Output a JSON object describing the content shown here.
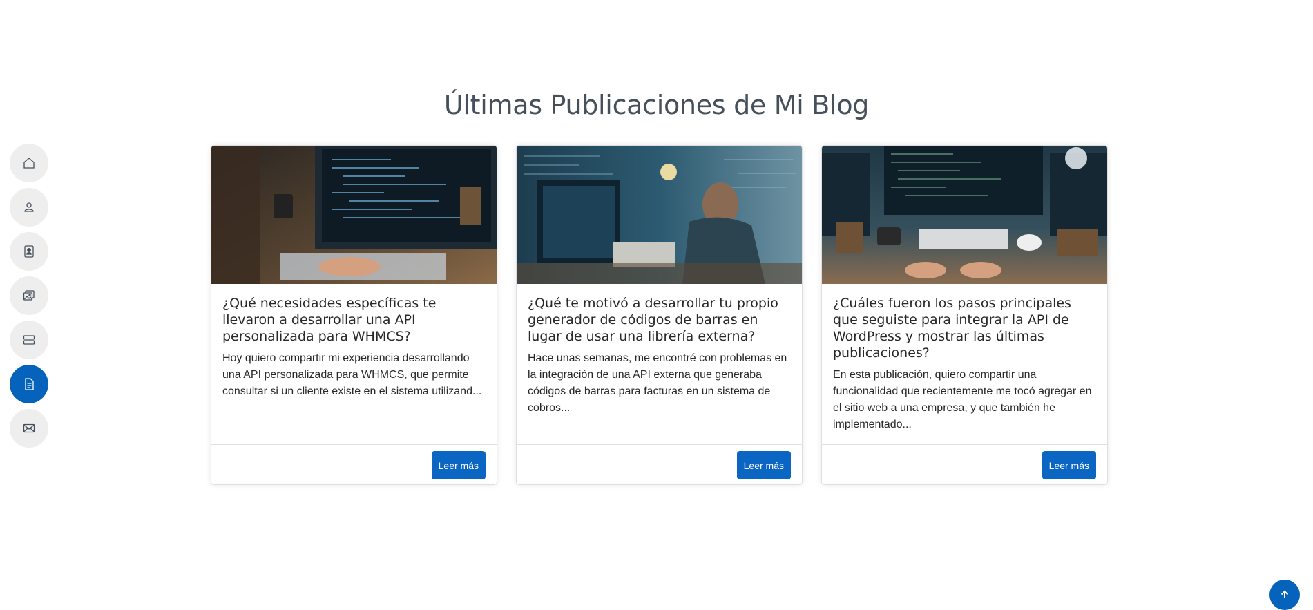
{
  "section": {
    "title": "Últimas Publicaciones de Mi Blog"
  },
  "nav": {
    "items": [
      {
        "icon": "house-icon",
        "active": false
      },
      {
        "icon": "person-icon",
        "active": false
      },
      {
        "icon": "file-person-icon",
        "active": false
      },
      {
        "icon": "images-icon",
        "active": false
      },
      {
        "icon": "server-icon",
        "active": false
      },
      {
        "icon": "file-text-icon",
        "active": true
      },
      {
        "icon": "envelope-icon",
        "active": false
      }
    ]
  },
  "posts": [
    {
      "title": "¿Qué necesidades específicas te llevaron a desarrollar una API personalizada para WHMCS?",
      "excerpt": "Hoy quiero compartir mi experiencia desarrollando una API personalizada para WHMCS, que permite consultar si un cliente existe en el sistema utilizand...",
      "button": "Leer más"
    },
    {
      "title": "¿Qué te motivó a desarrollar tu propio generador de códigos de barras en lugar de usar una librería externa?",
      "excerpt": "Hace unas semanas, me encontré con problemas en la integración de una API externa que generaba códigos de barras para facturas en un sistema de cobros...",
      "button": "Leer más"
    },
    {
      "title": "¿Cuáles fueron los pasos principales que seguiste para integrar la API de WordPress y mostrar las últimas publicaciones?",
      "excerpt": "En esta publicación, quiero compartir una funcionalidad que recientemente me tocó agregar en el sitio web a una empresa, y que también he implementado...",
      "button": "Leer más"
    }
  ],
  "colors": {
    "accent": "#0563bb",
    "button": "#0a66c2",
    "nav_bg": "#eeeeee",
    "heading": "#45505b"
  }
}
